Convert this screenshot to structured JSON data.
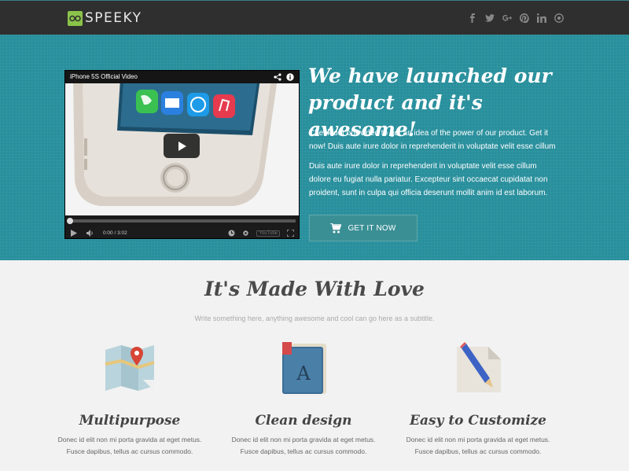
{
  "nav": {
    "logo_text": "SPEEKY",
    "social": [
      {
        "icon": "facebook-icon",
        "glyph": "f"
      },
      {
        "icon": "twitter-icon",
        "glyph": "t"
      },
      {
        "icon": "google-plus-icon",
        "glyph": "g+"
      },
      {
        "icon": "pinterest-icon",
        "glyph": "p"
      },
      {
        "icon": "linkedin-icon",
        "glyph": "in"
      },
      {
        "icon": "dribbble-icon",
        "glyph": "◎"
      }
    ]
  },
  "hero": {
    "video": {
      "title": "iPhone 5S Official Video",
      "time": "0:00 / 3:02",
      "progress": 0
    },
    "title": "We have launched our product and it's awesome!",
    "paragraph1": "Check out our video to get an idea of the power of our product. Get it now! Duis aute irure dolor in reprehenderit in voluptate velit esse cillum",
    "paragraph2": "Duis aute irure dolor in reprehenderit in voluptate velit esse cillum dolore eu fugiat nulla pariatur. Excepteur sint occaecat cupidatat non proident, sunt in culpa qui officia deserunt mollit anim id est laborum.",
    "cta_label": "GET IT NOW"
  },
  "features": {
    "title": "It's Made With Love",
    "subtitle": "Write something here, anything awesome and cool can go here as a subtitle.",
    "items": [
      {
        "title": "Multipurpose",
        "text": "Donec id elit non mi porta gravida at eget metus. Fusce dapibus, tellus ac cursus commodo.",
        "icon": "map-icon"
      },
      {
        "title": "Clean design",
        "text": "Donec id elit non mi porta gravida at eget metus. Fusce dapibus, tellus ac cursus commodo.",
        "icon": "book-icon"
      },
      {
        "title": "Easy to Customize",
        "text": "Donec id elit non mi porta gravida at eget metus. Fusce dapibus, tellus ac cursus commodo.",
        "icon": "pencil-icon"
      }
    ]
  },
  "colors": {
    "hero_bg": "#288f9c",
    "nav_bg": "#2f2f2f",
    "logo_accent": "#8bc34a"
  }
}
